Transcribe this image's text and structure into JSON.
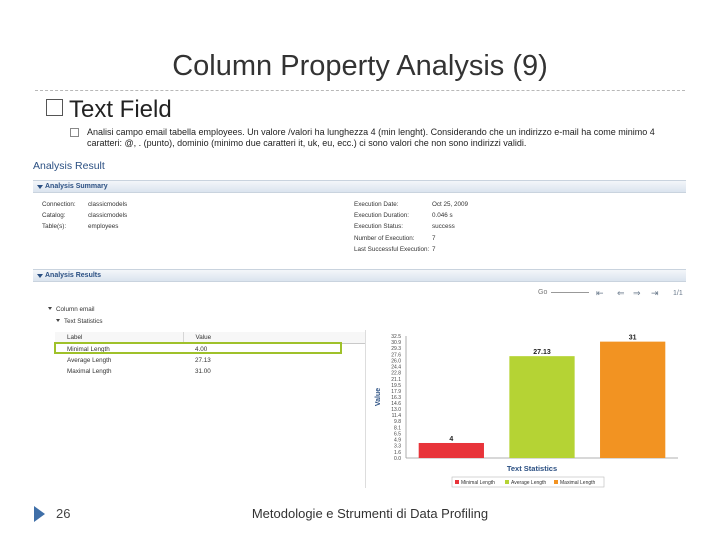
{
  "slide": {
    "title": "Column Property Analysis (9)",
    "heading": "Text Field",
    "bullet": "Analisi campo email tabella employees. Un valore /valori ha lunghezza 4 (min lenght). Considerando che un indirizzo e-mail ha come minimo 4 caratteri: @, . (punto), dominio (minimo due caratteri it, uk, eu, ecc.) ci sono valori che non sono indirizzi validi.",
    "page_number": "26",
    "footer": "Metodologie e Strumenti di Data Profiling"
  },
  "screenshot": {
    "title": "Analysis Result",
    "summary": {
      "header": "Analysis Summary",
      "left": [
        {
          "key": "Connection:",
          "value": "classicmodels"
        },
        {
          "key": "Catalog:",
          "value": "classicmodels"
        },
        {
          "key": "Table(s):",
          "value": "employees"
        }
      ],
      "right": [
        {
          "key": "Execution Date:",
          "value": "Oct 25, 2009"
        },
        {
          "key": "Execution Duration:",
          "value": "0.046 s"
        },
        {
          "key": "Execution Status:",
          "value": "success"
        },
        {
          "key": "Number of Execution:",
          "value": "7"
        },
        {
          "key": "Last Successful Execution:",
          "value": "7"
        }
      ]
    },
    "results": {
      "header": "Analysis Results",
      "nav_label": "Go",
      "nav_page": "1/1",
      "column_node": "Column email",
      "stat_node": "Text Statistics",
      "table": {
        "headers": [
          "Label",
          "Value"
        ],
        "rows": [
          {
            "label": "Minimal Length",
            "value": "4.00"
          },
          {
            "label": "Average Length",
            "value": "27.13"
          },
          {
            "label": "Maximal Length",
            "value": "31.00"
          }
        ]
      }
    }
  },
  "chart_data": {
    "type": "bar",
    "title": "Text Statistics",
    "ylabel": "Value",
    "categories": [
      "Minimal Length",
      "Average Length",
      "Maximal Length"
    ],
    "values": [
      4,
      27.13,
      31
    ],
    "value_labels": [
      "4",
      "27.13",
      "31"
    ],
    "legend": [
      "Minimal Length",
      "Average Length",
      "Maximal Length"
    ],
    "colors": [
      "#e8343a",
      "#b5d334",
      "#f29322"
    ],
    "yticks": [
      "0.0",
      "1.6",
      "3.3",
      "4.9",
      "6.5",
      "8.1",
      "9.8",
      "11.4",
      "13.0",
      "14.6",
      "16.3",
      "17.9",
      "19.5",
      "21.1",
      "22.8",
      "24.4",
      "26.0",
      "27.6",
      "29.3",
      "30.9",
      "32.5"
    ],
    "ylim": [
      0,
      32.5
    ],
    "legend_position": "bottom"
  }
}
